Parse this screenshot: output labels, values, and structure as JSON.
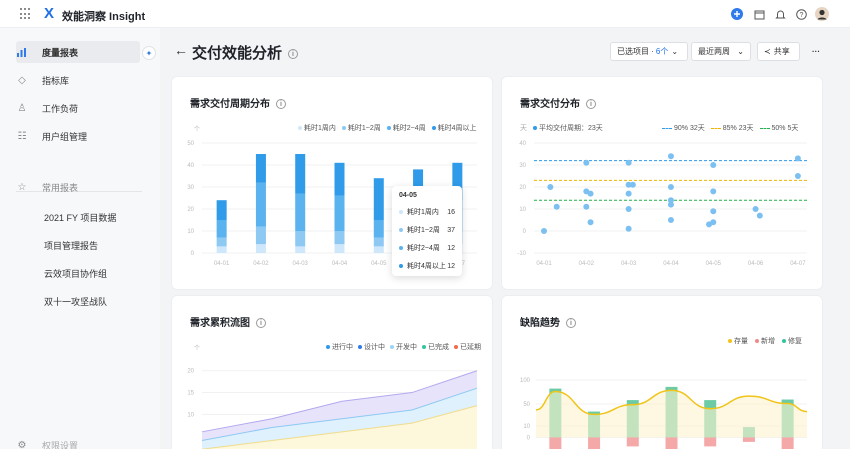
{
  "app": {
    "title": "效能洞察 Insight",
    "logo": "X"
  },
  "topbar_icons": [
    "plus-circle-icon",
    "calendar-icon",
    "bell-icon",
    "help-icon",
    "avatar"
  ],
  "sidebar": {
    "items": [
      {
        "icon": "bar-chart-icon",
        "label": "度量报表",
        "active": true
      },
      {
        "icon": "layers-icon",
        "label": "指标库"
      },
      {
        "icon": "people-icon",
        "label": "工作负荷"
      },
      {
        "icon": "group-icon",
        "label": "用户组管理"
      }
    ],
    "starred_label": "常用报表",
    "starred": [
      "2021 FY 项目数据",
      "项目管理报告",
      "云效项目协作组",
      "双十一攻坚战队"
    ],
    "settings_label": "权限设置"
  },
  "header": {
    "title": "交付效能分析",
    "selected_label": "已选项目 · ",
    "selected_count": "6个",
    "range_label": "最近两周",
    "share_label": "共享",
    "more": "···"
  },
  "colors": {
    "c1": "#cfe7fb",
    "c2": "#8ec9f3",
    "c3": "#5ab2ef",
    "c4": "#2f9be9",
    "accent": "#1e6fe8"
  },
  "cards": {
    "cycle": {
      "title": "需求交付周期分布",
      "unit": "个",
      "legend": [
        "耗时1周内",
        "耗时1~2周",
        "耗时2~4周",
        "耗时4周以上"
      ],
      "tooltip": {
        "date": "04-05",
        "rows": [
          {
            "label": "耗时1周内",
            "value": "16"
          },
          {
            "label": "耗时1~2周",
            "value": "37"
          },
          {
            "label": "耗时2~4周",
            "value": "12"
          },
          {
            "label": "耗时4周以上",
            "value": "12"
          }
        ]
      }
    },
    "delivery": {
      "title": "需求交付分布",
      "unit": "天",
      "legend_avg": "平均交付周期：23天",
      "legend_pcts": [
        "90%  32天",
        "85%  23天",
        "50%  5天"
      ]
    },
    "cfd": {
      "title": "需求累积流图",
      "unit": "个",
      "legend": [
        "进行中",
        "设计中",
        "开发中",
        "已完成",
        "已延期"
      ]
    },
    "defect": {
      "title": "缺陷趋势",
      "legend": [
        "存量",
        "新增",
        "修复"
      ]
    }
  },
  "chart_data": [
    {
      "type": "bar",
      "title": "需求交付周期分布",
      "ylabel": "个",
      "ylim": [
        0,
        50
      ],
      "yticks": [
        "0",
        "10",
        "20",
        "30",
        "40",
        "50"
      ],
      "categories": [
        "04-01",
        "04-02",
        "04-03",
        "04-04",
        "04-05",
        "04-06",
        "04-07"
      ],
      "series": [
        {
          "name": "耗时1周内",
          "values": [
            3,
            4,
            3,
            4,
            3,
            4,
            4
          ]
        },
        {
          "name": "耗时1~2周",
          "values": [
            4,
            8,
            7,
            6,
            4,
            8,
            6
          ]
        },
        {
          "name": "耗时2~4周",
          "values": [
            8,
            20,
            17,
            16,
            8,
            18,
            14
          ]
        },
        {
          "name": "耗时4周以上",
          "values": [
            9,
            13,
            18,
            15,
            19,
            8,
            17
          ]
        }
      ]
    },
    {
      "type": "scatter",
      "title": "需求交付分布",
      "ylabel": "天",
      "ylim": [
        -10,
        40
      ],
      "yticks": [
        "-10",
        "0",
        "10",
        "20",
        "30",
        "40"
      ],
      "categories": [
        "04-01",
        "04-02",
        "04-03",
        "04-04",
        "04-05",
        "04-06",
        "04-07"
      ],
      "points": [
        [
          0,
          0
        ],
        [
          0.15,
          20
        ],
        [
          0.3,
          11
        ],
        [
          1,
          31
        ],
        [
          1,
          18
        ],
        [
          1,
          11
        ],
        [
          1.1,
          4
        ],
        [
          1.1,
          17
        ],
        [
          2,
          31
        ],
        [
          2,
          21
        ],
        [
          2.1,
          21
        ],
        [
          2,
          17
        ],
        [
          2,
          10
        ],
        [
          2,
          1
        ],
        [
          3,
          34
        ],
        [
          3,
          20
        ],
        [
          3,
          14
        ],
        [
          3,
          12
        ],
        [
          3,
          5
        ],
        [
          4,
          30
        ],
        [
          4,
          18
        ],
        [
          4,
          9
        ],
        [
          3.9,
          3
        ],
        [
          4,
          4
        ],
        [
          5,
          10
        ],
        [
          5.1,
          7
        ],
        [
          6,
          33
        ],
        [
          6,
          25
        ]
      ],
      "reference_lines": [
        {
          "name": "90%",
          "value": 32
        },
        {
          "name": "85%",
          "value": 23
        },
        {
          "name": "50%",
          "value": 14
        }
      ]
    },
    {
      "type": "area",
      "title": "需求累积流图",
      "ylabel": "个",
      "yticks": [
        "20",
        "15",
        "10"
      ],
      "ylim": [
        0,
        22
      ]
    },
    {
      "type": "bar",
      "title": "缺陷趋势",
      "yticks": [
        "100",
        "50",
        "10",
        "0"
      ],
      "ylim": [
        -15,
        100
      ],
      "series": [
        {
          "name": "存量",
          "values": [
            80,
            40,
            57,
            82,
            50,
            72,
            59
          ]
        },
        {
          "name": "新增",
          "values": [
            85,
            45,
            65,
            88,
            65,
            18,
            66
          ]
        },
        {
          "name": "修复",
          "values": [
            -15,
            -30,
            -10,
            -15,
            -10,
            -5,
            -20
          ]
        }
      ]
    }
  ]
}
